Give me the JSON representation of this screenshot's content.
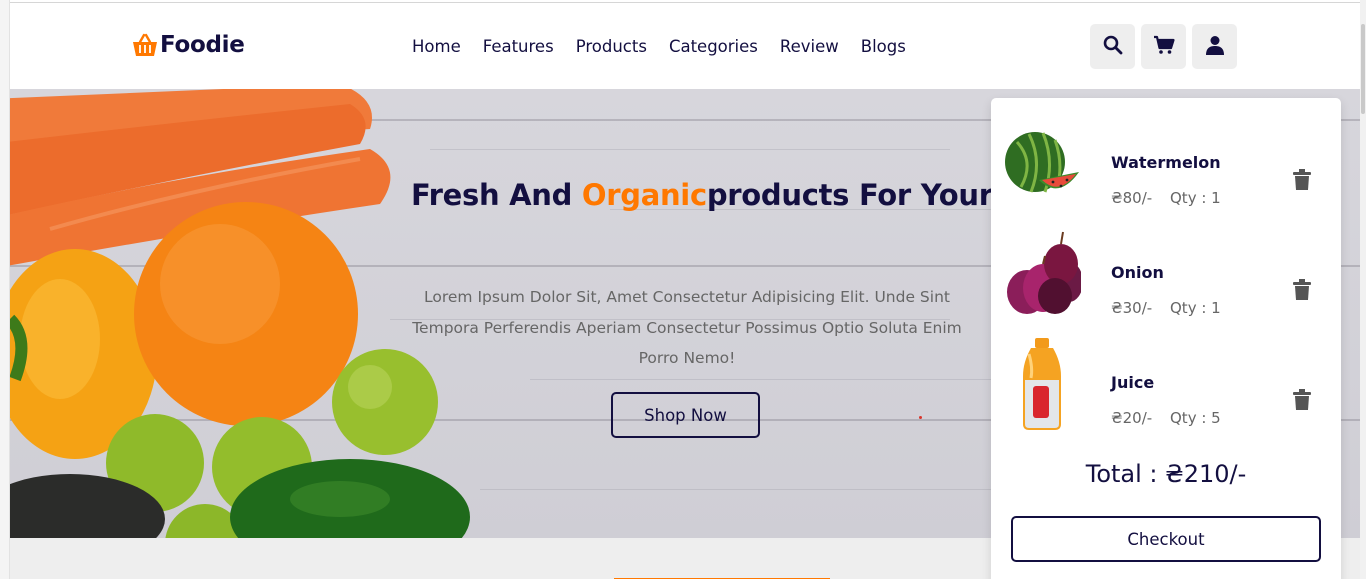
{
  "header": {
    "logo_text": "Foodie",
    "logo_icon": "shopping-basket-icon",
    "nav": [
      {
        "label": "Home"
      },
      {
        "label": "Features"
      },
      {
        "label": "Products"
      },
      {
        "label": "Categories"
      },
      {
        "label": "Review"
      },
      {
        "label": "Blogs"
      }
    ],
    "icons": [
      "search-icon",
      "cart-icon",
      "user-icon"
    ]
  },
  "hero": {
    "title_before": "Fresh And ",
    "title_accent": "Organic",
    "title_after": "products For Your",
    "description": "Lorem Ipsum Dolor Sit, Amet Consectetur Adipisicing Elit. Unde Sint Tempora Perferendis Aperiam Consectetur Possimus Optio Soluta Enim Porro Nemo!",
    "button_label": "Shop Now"
  },
  "cart": {
    "items": [
      {
        "name": "Watermelon",
        "price": "₴80/-",
        "qty": "Qty : 1",
        "image": "watermelon-image"
      },
      {
        "name": "Onion",
        "price": "₴30/-",
        "qty": "Qty : 1",
        "image": "onion-image"
      },
      {
        "name": "Juice",
        "price": "₴20/-",
        "qty": "Qty : 5",
        "image": "juice-bottle-image"
      }
    ],
    "total": "Total : ₴210/-",
    "checkout_label": "Checkout"
  },
  "colors": {
    "primary": "#130f40",
    "accent": "#ff7800",
    "text_muted": "#666666",
    "icon_bg": "#eeeeee"
  }
}
